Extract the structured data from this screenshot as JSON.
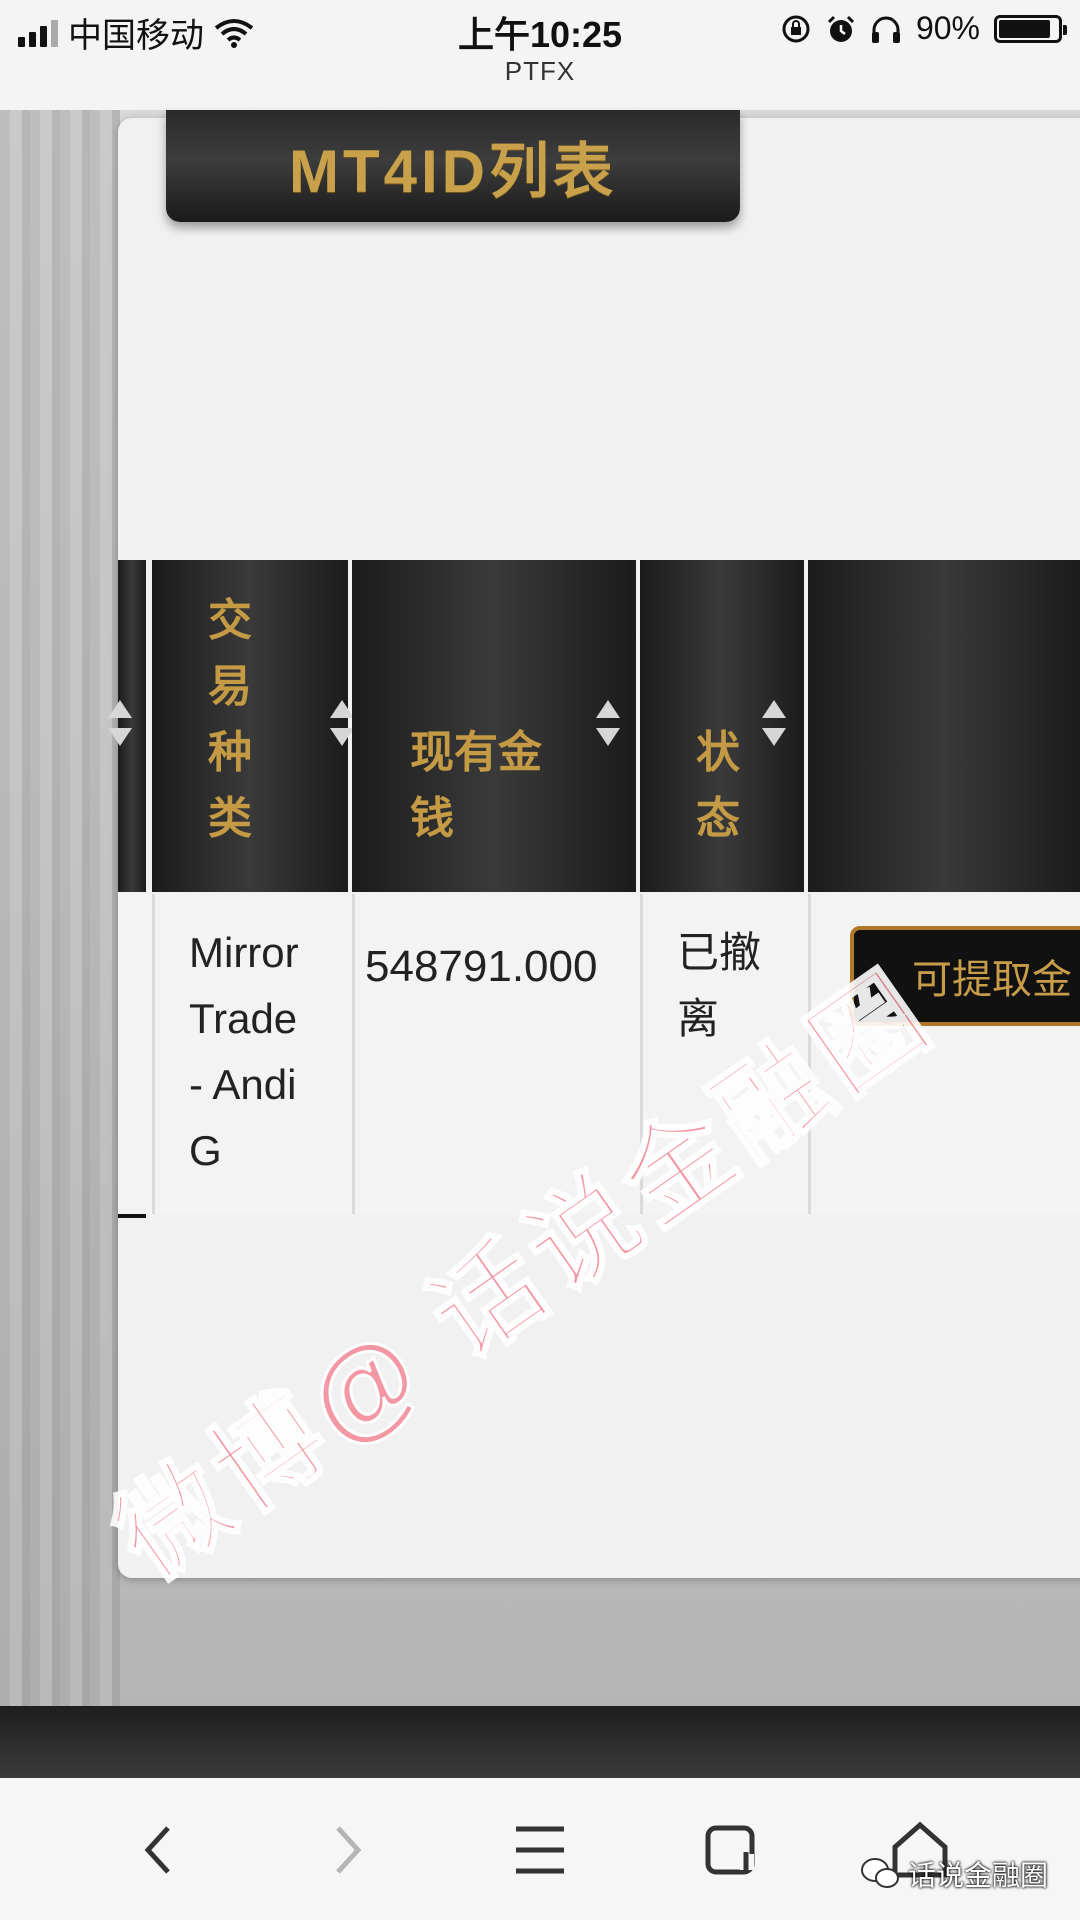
{
  "status_bar": {
    "carrier": "中国移动",
    "time": "上午10:25",
    "site": "PTFX",
    "battery": "90%",
    "battery_level": 0.9
  },
  "page": {
    "title": "MT4ID列表"
  },
  "table": {
    "columns": [
      {
        "label": "交\n易\n种\n类"
      },
      {
        "label": "现有金\n钱"
      },
      {
        "label": "状\n态"
      },
      {
        "label": ""
      }
    ],
    "rows": [
      {
        "trade_type": "Mirror\nTrade\n- Andi\nG",
        "balance": "548791.000",
        "status": "已撤\n离",
        "action_label": "可提取金"
      }
    ]
  },
  "watermark": {
    "text": "微博@ 话说金融圈",
    "badge": "话说金融圈"
  },
  "icons": [
    "signal-icon",
    "wifi-icon",
    "lock-rotation-icon",
    "alarm-icon",
    "headphones-icon",
    "battery-icon",
    "back-icon",
    "forward-icon",
    "menu-icon",
    "tabs-icon",
    "home-icon",
    "wechat-icon"
  ]
}
